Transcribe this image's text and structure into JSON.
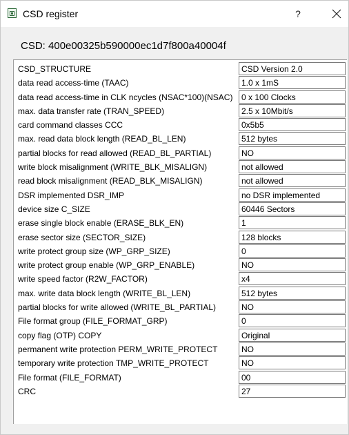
{
  "window": {
    "title": "CSD register",
    "help_label": "?",
    "close_icon": "close-icon"
  },
  "csd_header": "CSD: 400e00325b590000ec1d7f800a40004f",
  "rows": [
    {
      "label": "CSD_STRUCTURE",
      "value": "CSD Version 2.0"
    },
    {
      "label": "data read access-time (TAAC)",
      "value": "1.0 x 1mS"
    },
    {
      "label": "data read access-time in CLK ncycles (NSAC*100)(NSAC)",
      "value": "0 x 100 Clocks"
    },
    {
      "label": "max. data transfer rate (TRAN_SPEED)",
      "value": "2.5 x 10Mbit/s"
    },
    {
      "label": "card command classes CCC",
      "value": "0x5b5"
    },
    {
      "label": "max. read data block length (READ_BL_LEN)",
      "value": "512 bytes"
    },
    {
      "label": "partial blocks for read allowed (READ_BL_PARTIAL)",
      "value": "NO"
    },
    {
      "label": "write block misalignment (WRITE_BLK_MISALIGN)",
      "value": "not allowed"
    },
    {
      "label": "read block misalignment (READ_BLK_MISALIGN)",
      "value": "not allowed"
    },
    {
      "label": "DSR implemented DSR_IMP",
      "value": "no DSR implemented"
    },
    {
      "label": "device size C_SIZE",
      "value": "60446 Sectors"
    },
    {
      "label": "erase single block enable (ERASE_BLK_EN)",
      "value": "1"
    },
    {
      "label": "erase sector size (SECTOR_SIZE)",
      "value": "128 blocks"
    },
    {
      "label": "write protect group size (WP_GRP_SIZE)",
      "value": "0"
    },
    {
      "label": "write protect group enable (WP_GRP_ENABLE)",
      "value": "NO"
    },
    {
      "label": "write speed factor (R2W_FACTOR)",
      "value": "x4"
    },
    {
      "label": "max. write data block length (WRITE_BL_LEN)",
      "value": "512 bytes"
    },
    {
      "label": "partial blocks for write allowed (WRITE_BL_PARTIAL)",
      "value": "NO"
    },
    {
      "label": "File format group (FILE_FORMAT_GRP)",
      "value": "0"
    },
    {
      "label": "copy flag (OTP) COPY",
      "value": "Original"
    },
    {
      "label": "permanent write protection PERM_WRITE_PROTECT",
      "value": "NO"
    },
    {
      "label": "temporary write protection TMP_WRITE_PROTECT",
      "value": "NO"
    },
    {
      "label": "File format (FILE_FORMAT)",
      "value": "00"
    },
    {
      "label": "CRC",
      "value": "27"
    }
  ]
}
